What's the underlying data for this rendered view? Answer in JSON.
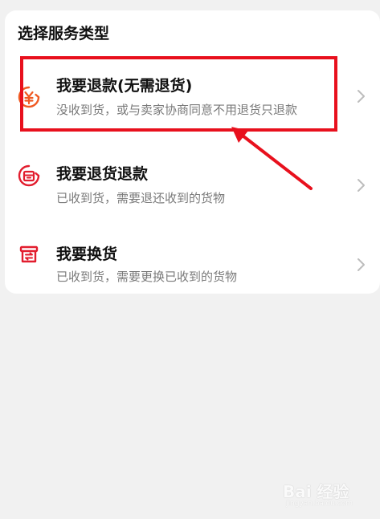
{
  "section_title": "选择服务类型",
  "options": [
    {
      "title": "我要退款(无需退货)",
      "subtitle": "没收到货，或与卖家协商同意不用退货只退款",
      "icon": "yen-refund-icon",
      "icon_color": "#f05a23"
    },
    {
      "title": "我要退货退款",
      "subtitle": "已收到货，需要退还收到的货物",
      "icon": "return-refund-icon",
      "icon_color": "#e21d2e"
    },
    {
      "title": "我要换货",
      "subtitle": "已收到货，需要更换已收到的货物",
      "icon": "exchange-box-icon",
      "icon_color": "#e21d2e"
    }
  ],
  "annotation": {
    "color": "#e8101d"
  },
  "watermark": {
    "text": "Bai 经验",
    "sub": "jingyan.baidu.com"
  }
}
